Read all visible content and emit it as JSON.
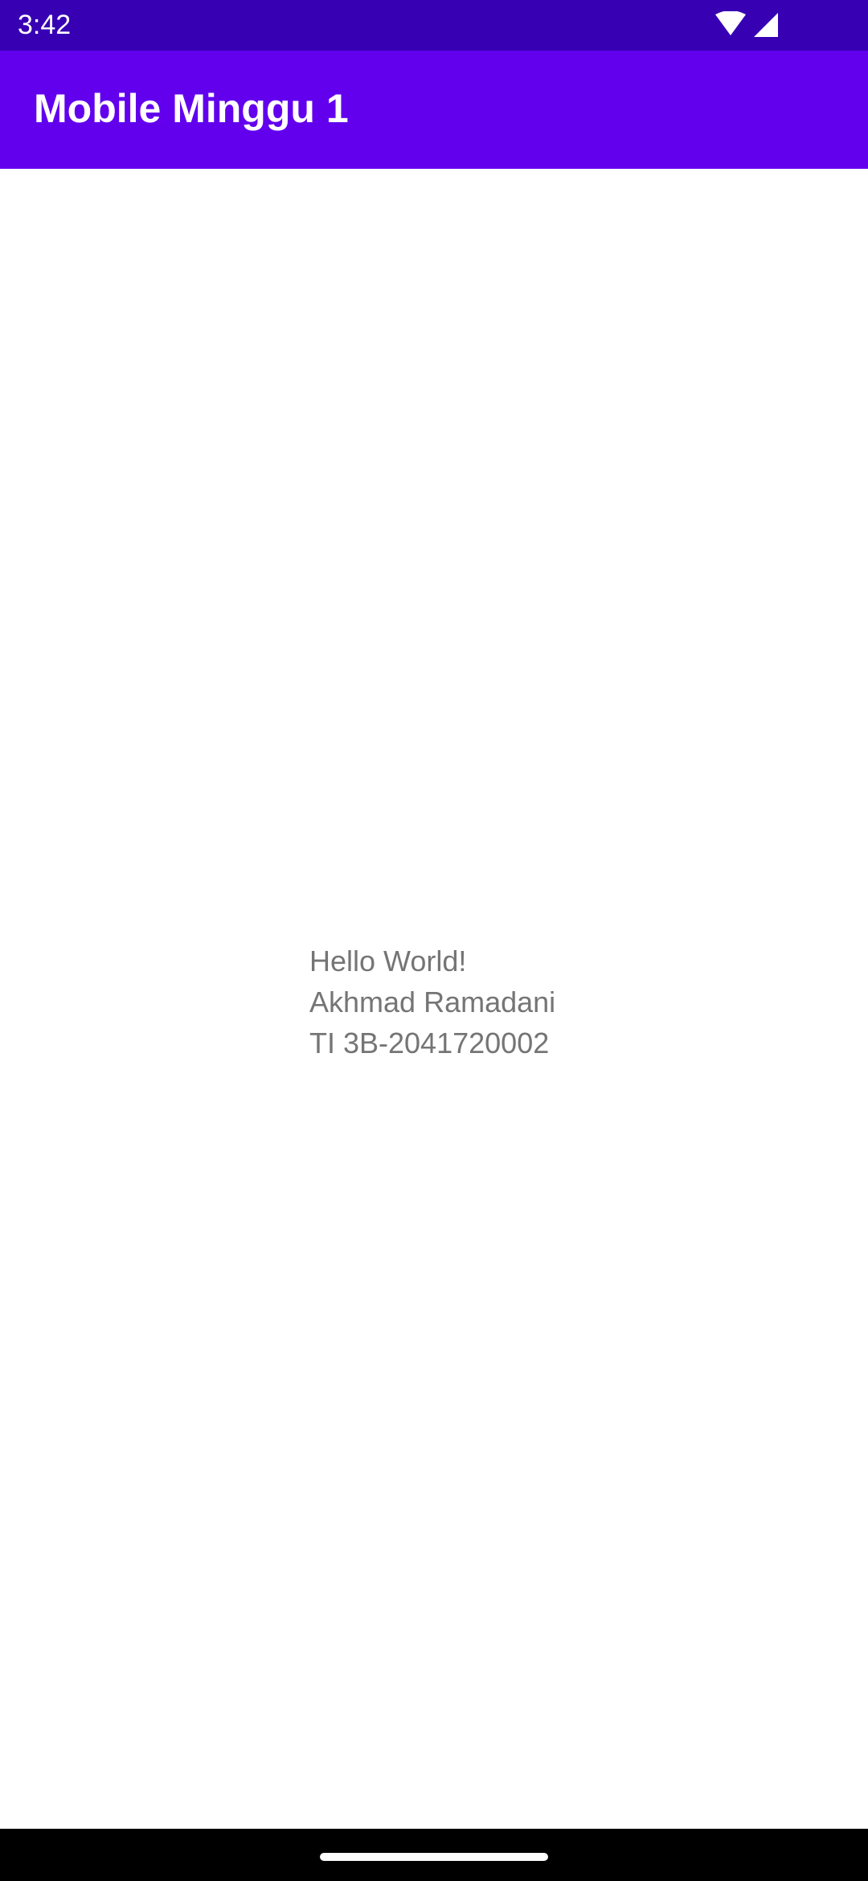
{
  "status_bar": {
    "time": "3:42",
    "icons": [
      "wifi-icon",
      "cellular-signal-icon"
    ],
    "background": "#3700b3"
  },
  "app_bar": {
    "title": "Mobile Minggu 1",
    "background": "#6200ee"
  },
  "content": {
    "lines": [
      "Hello World!",
      "Akhmad Ramadani",
      "TI 3B-2041720002"
    ],
    "text_color": "#757575"
  },
  "nav_bar": {
    "indicator": "home-indicator",
    "background": "#000000"
  }
}
